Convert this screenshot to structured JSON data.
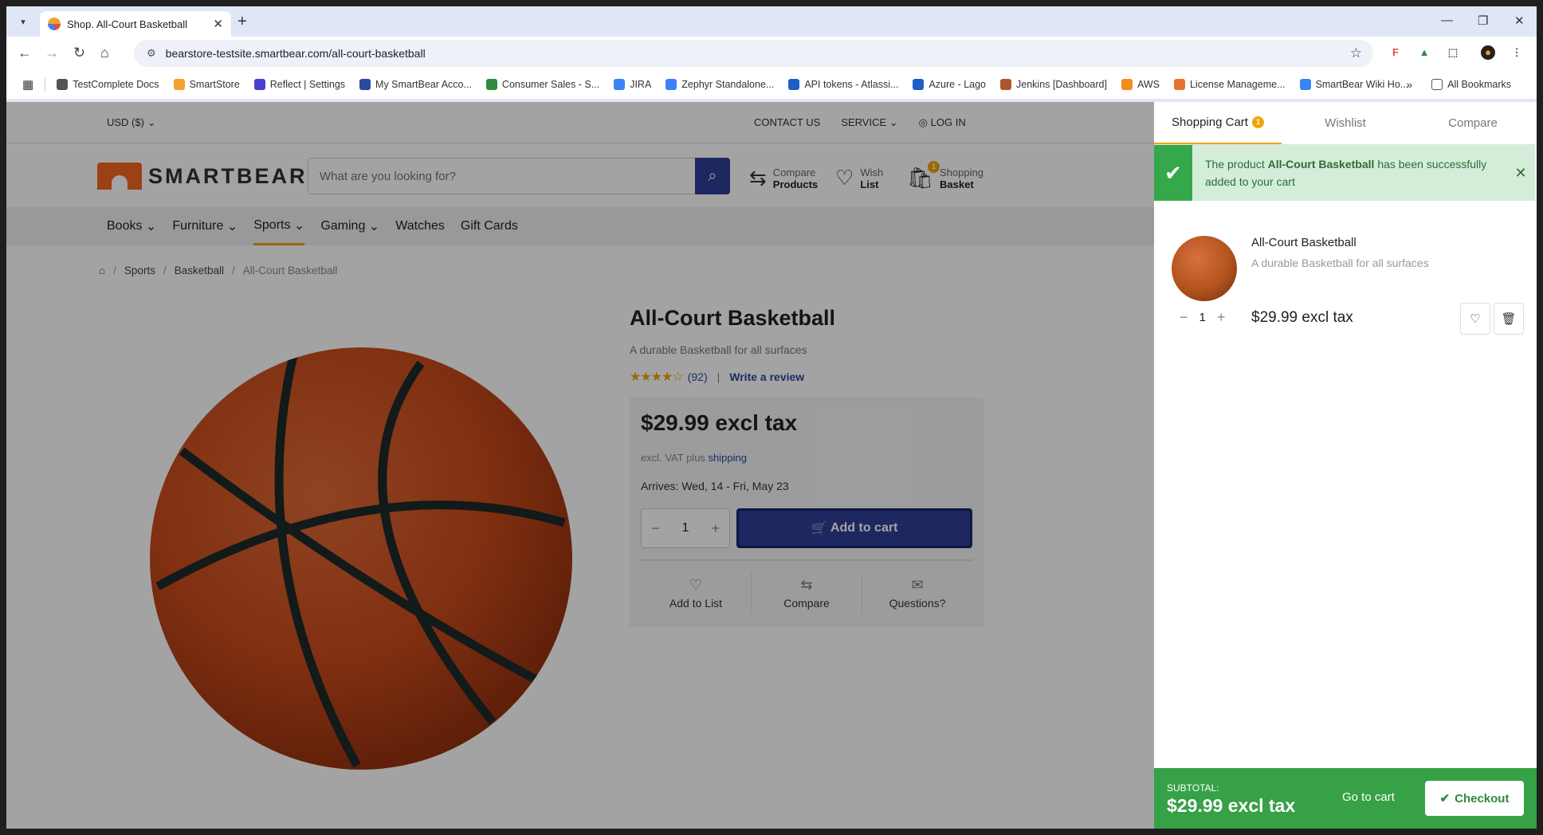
{
  "browser": {
    "tab_title": "Shop. All-Court Basketball",
    "url": "bearstore-testsite.smartbear.com/all-court-basketball",
    "bookmarks": [
      "TestComplete Docs",
      "SmartStore",
      "Reflect | Settings",
      "My SmartBear Acco...",
      "Consumer Sales - S...",
      "JIRA",
      "Zephyr Standalone...",
      "API tokens - Atlassi...",
      "Azure - Lago",
      "Jenkins [Dashboard]",
      "AWS",
      "License Manageme...",
      "SmartBear Wiki Ho..."
    ],
    "all_bookmarks": "All Bookmarks",
    "bookmark_colors": [
      "#555555",
      "#f4a02d",
      "#4a3fd1",
      "#2a4a9e",
      "#2f8a3d",
      "#3a82f7",
      "#3a82f7",
      "#1f5fc4",
      "#1f5fc4",
      "#b0562d",
      "#f28c1a",
      "#e6732c",
      "#3a82f7"
    ]
  },
  "store": {
    "currency": "USD  ($)",
    "topnav": [
      "CONTACT US",
      "SERVICE",
      "LOG IN"
    ],
    "logo_text": "SMARTBEAR",
    "search_placeholder": "What are you looking for?",
    "compare": {
      "line1": "Compare",
      "line2": "Products"
    },
    "wish": {
      "line1": "Wish",
      "line2": "List"
    },
    "basket": {
      "line1": "Shopping",
      "line2": "Basket",
      "count": "1"
    },
    "nav": [
      "Books",
      "Furniture",
      "Sports",
      "Gaming",
      "Watches",
      "Gift Cards"
    ],
    "active_nav": "Sports",
    "breadcrumb": [
      "Sports",
      "Basketball",
      "All-Court Basketball"
    ]
  },
  "product": {
    "name": "All-Court Basketball",
    "short_desc": "A durable Basketball for all surfaces",
    "rating_count": "(92)",
    "rating": 4,
    "write_review": "Write a review",
    "price": "$29.99 excl tax",
    "vat_text": "excl. VAT plus",
    "shipping": "shipping",
    "arrives_label": "Arrives:",
    "arrives_value": "Wed, 14 - Fri, May 23",
    "qty": "1",
    "add_to_cart": "Add to cart",
    "actions": [
      "Add to List",
      "Compare",
      "Questions?"
    ]
  },
  "cart": {
    "tabs": [
      "Shopping Cart",
      "Wishlist",
      "Compare"
    ],
    "tab_badge": "1",
    "notice_pre": "The product",
    "notice_product": "All-Court Basketball",
    "notice_post": "has been successfully added to your cart",
    "item_name": "All-Court Basketball",
    "item_desc": "A durable Basketball for all surfaces",
    "item_qty": "1",
    "item_price": "$29.99 excl tax",
    "subtotal_label": "SUBTOTAL:",
    "subtotal_value": "$29.99 excl tax",
    "go_to_cart": "Go to cart",
    "checkout": "Checkout"
  },
  "colors": {
    "accent": "#f0a40c",
    "primary": "#2f3e97",
    "success": "#36a146"
  }
}
